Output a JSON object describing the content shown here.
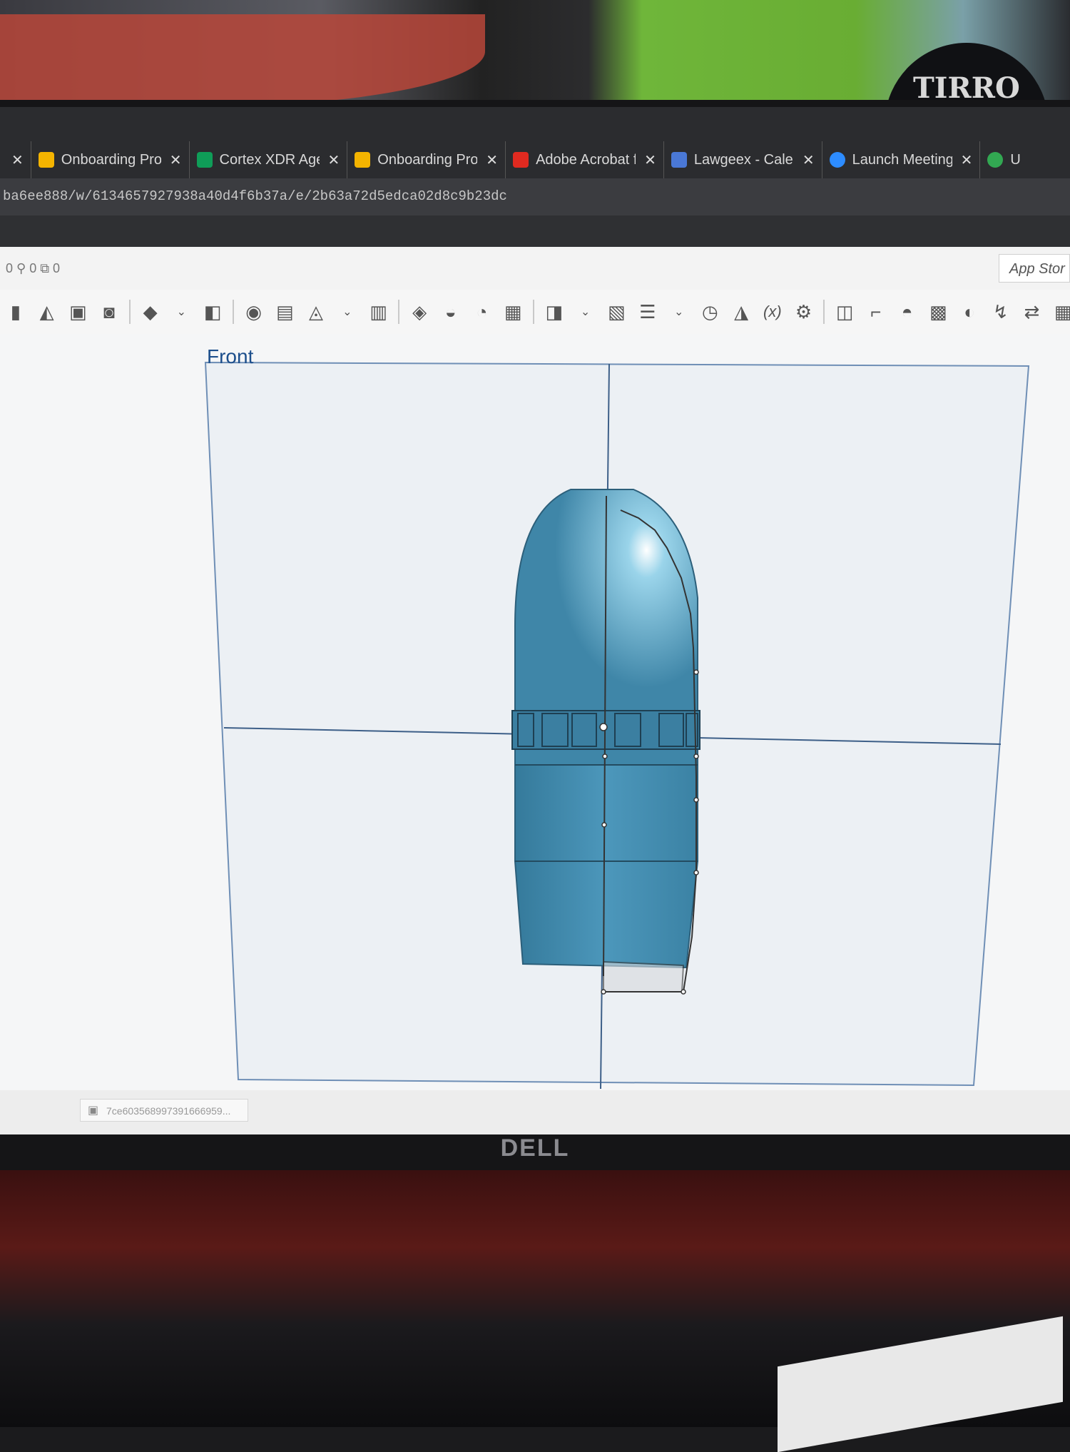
{
  "browser": {
    "tabs": [
      {
        "label": "Onboarding Pro",
        "favicon_color": "#f4b400"
      },
      {
        "label": "Cortex XDR Age",
        "favicon_color": "#0f9d58"
      },
      {
        "label": "Onboarding Pro",
        "favicon_color": "#f4b400"
      },
      {
        "label": "Adobe Acrobat f",
        "favicon_color": "#e02a20"
      },
      {
        "label": "Lawgeex - Calen",
        "favicon_color": "#4a78d6"
      },
      {
        "label": "Launch Meeting",
        "favicon_color": "#2d8cff"
      },
      {
        "label": "U",
        "favicon_color": "#32a852"
      }
    ],
    "tab_close_glyph": "✕",
    "url": "ba6ee888/w/6134657927938a40d4f6b37a/e/2b63a72d5edca02d8c9b23dc"
  },
  "app": {
    "counts_text": "0  ⚲ 0  ⧉ 0",
    "app_store_label": "App Stor",
    "view_label": "Front",
    "status_chip_text": "7ce6035689973916669​59...",
    "model_color": "#3f86a8"
  },
  "monitor": {
    "brand": "DELL"
  }
}
